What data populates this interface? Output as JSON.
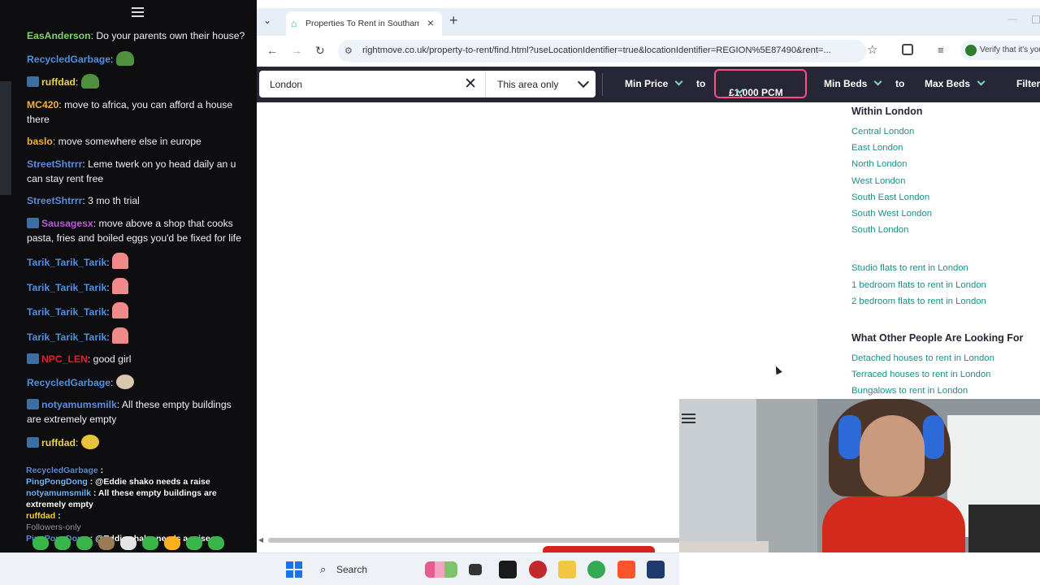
{
  "chat": {
    "messages": [
      {
        "user": "EasAnderson",
        "color": "#7fd36b",
        "text": ": Do your parents own their house?",
        "emote": ""
      },
      {
        "user": "RecycledGarbage",
        "color": "#4f8fe0",
        "text": ":",
        "emote": "frog"
      },
      {
        "user": "ruffdad",
        "color": "#e8d44b",
        "text": ":",
        "emote": "frog",
        "badges": true
      },
      {
        "user": "MC420",
        "color": "#f0b03a",
        "text": ": move to africa, you can afford a house there",
        "emote": ""
      },
      {
        "user": "baslo",
        "color": "#f0b03a",
        "text": ": move somewhere else in europe",
        "emote": ""
      },
      {
        "user": "StreetShtrrr",
        "color": "#5c8ad9",
        "text": ": Leme twerk on yo head daily an u can stay rent free",
        "emote": ""
      },
      {
        "user": "StreetShtrrr",
        "color": "#5c8ad9",
        "text": ": 3 mo th trial",
        "emote": ""
      },
      {
        "user": "Sausagesx",
        "color": "#b65bd8",
        "text": ": move above a shop that cooks pasta, fries and boiled eggs you'd be fixed for life",
        "emote": "",
        "badges": true
      },
      {
        "user": "Tarik_Tarik_Tarik",
        "color": "#4f8fe0",
        "text": ":",
        "emote": "pat"
      },
      {
        "user": "Tarik_Tarik_Tarik",
        "color": "#4f8fe0",
        "text": ":",
        "emote": "pat"
      },
      {
        "user": "Tarik_Tarik_Tarik",
        "color": "#4f8fe0",
        "text": ":",
        "emote": "pat"
      },
      {
        "user": "Tarik_Tarik_Tarik",
        "color": "#4f8fe0",
        "text": ":",
        "emote": "pat"
      },
      {
        "user": "NPC_LEN",
        "color": "#e0202f",
        "text": ": good girl",
        "emote": "",
        "badges": true
      },
      {
        "user": "RecycledGarbage",
        "color": "#4f8fe0",
        "text": ":",
        "emote": "dog"
      },
      {
        "user": "notyamumsmilk",
        "color": "#5c8ad9",
        "text": ": All these empty buildings are extremely empty",
        "emote": "",
        "badges": true
      },
      {
        "user": "ruffdad",
        "color": "#e8d44b",
        "text": ":",
        "emote": "yellow",
        "badges": true
      }
    ],
    "overlay": {
      "line1_user": "RecycledGarbage",
      "line1_text": " :",
      "line2_user": "PingPongDong",
      "line2_text": " : @Eddie shako needs a raise",
      "line3_user": "notyamumsmilk",
      "line3_text": " : All these empty buildings are extremely empty",
      "line4_user": "ruffdad",
      "line4_text": " :",
      "line5_text": "Followers-only",
      "line6_user": "PingPongDong",
      "line6_text": " : @Eddie shako needs a raise"
    }
  },
  "browser": {
    "tab_title": "Properties To Rent in Southampton",
    "url": "rightmove.co.uk/property-to-rent/find.html?useLocationIdentifier=true&locationIdentifier=REGION%5E87490&rent=...",
    "verify_label": "Verify that it's you"
  },
  "search": {
    "location": "London",
    "radius": "This area only",
    "min_price": "Min Price",
    "to1": "to",
    "max_price": "£1,000 PCM",
    "min_beds": "Min Beds",
    "to2": "to",
    "max_beds": "Max Beds",
    "filters": "Filters"
  },
  "sidebar": {
    "within_heading": "Within London",
    "areas": [
      "Central London",
      "East London",
      "North London",
      "West London",
      "South East London",
      "South West London",
      "South London"
    ],
    "flat_links": [
      "Studio flats to rent in London",
      "1 bedroom flats to rent in London",
      "2 bedroom flats to rent in London"
    ],
    "others_heading": "What Other People Are Looking For",
    "other_links": [
      "Detached houses to rent in London",
      "Terraced houses to rent in London",
      "Bungalows to rent in London"
    ]
  },
  "taskbar": {
    "search_label": "Search"
  },
  "colors": {
    "accent_teal": "#1d8e8b",
    "rightmove_navy": "#262637",
    "highlight_pink": "#ff4e80"
  }
}
